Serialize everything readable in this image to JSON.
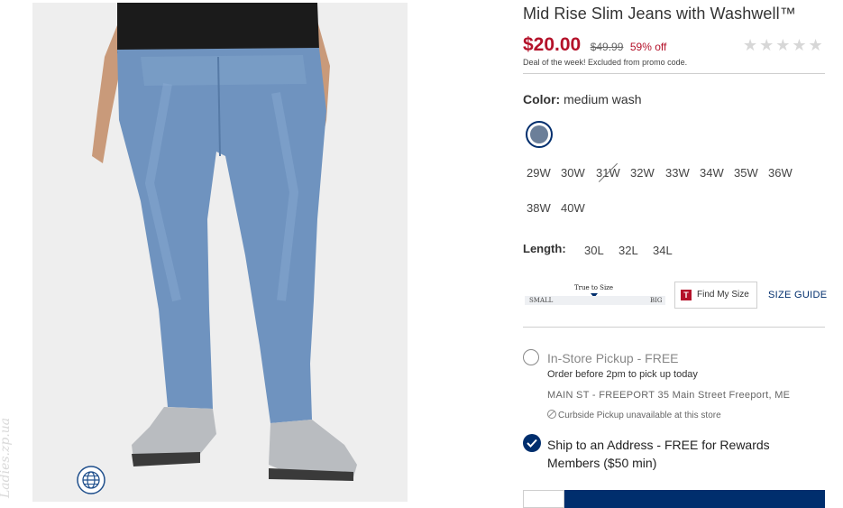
{
  "product": {
    "title": "Mid Rise Slim Jeans with Washwell™",
    "sale_price": "$20.00",
    "original_price": "$49.99",
    "discount": "59% off",
    "rating_stars": "★★★★★",
    "deal_note": "Deal of the week! Excluded from promo code."
  },
  "color": {
    "label": "Color:",
    "value": "medium wash",
    "swatch_hex": "#6b7f99"
  },
  "waist_sizes": [
    {
      "label": "29W",
      "available": true
    },
    {
      "label": "30W",
      "available": true
    },
    {
      "label": "31W",
      "available": false
    },
    {
      "label": "32W",
      "available": true
    },
    {
      "label": "33W",
      "available": true
    },
    {
      "label": "34W",
      "available": true
    },
    {
      "label": "35W",
      "available": true
    },
    {
      "label": "36W",
      "available": true
    },
    {
      "label": "38W",
      "available": true
    },
    {
      "label": "40W",
      "available": true
    }
  ],
  "length": {
    "label": "Length:",
    "options": [
      "30L",
      "32L",
      "34L"
    ]
  },
  "fit_scale": {
    "true_label": "True to Size",
    "small_label": "SMALL",
    "big_label": "BIG"
  },
  "find_my_size": {
    "icon_letter": "T",
    "label": "Find My Size"
  },
  "size_guide_label": "SIZE GUIDE",
  "fulfillment": {
    "pickup_label": "In-Store Pickup - FREE",
    "pickup_note": "Order before 2pm to pick up today",
    "store_line": "MAIN ST - FREEPORT 35 Main Street Freeport, ME",
    "curbside_note": "Curbside Pickup unavailable at this store",
    "ship_label": "Ship to an Address - FREE for Rewards Members ($50 min)"
  },
  "watermark": "Ladies.zp.ua",
  "colors": {
    "brand_navy": "#002e6d",
    "sale_red": "#b4122a"
  }
}
